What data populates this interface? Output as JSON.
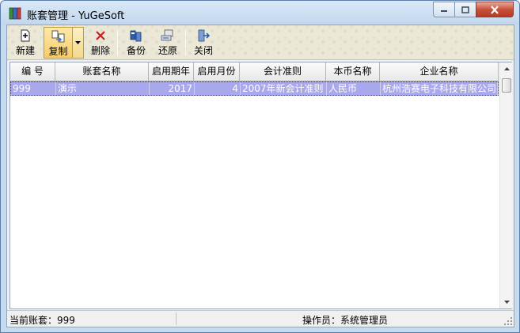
{
  "window": {
    "title": "账套管理 - YuGeSoft"
  },
  "toolbar": {
    "new_label": "新建",
    "copy_label": "复制",
    "delete_label": "删除",
    "backup_label": "备份",
    "restore_label": "还原",
    "close_label": "关闭"
  },
  "table": {
    "columns": [
      "编 号",
      "账套名称",
      "启用期年",
      "启用月份",
      "会计准则",
      "本币名称",
      "企业名称"
    ],
    "rows": [
      [
        "999",
        "演示",
        "2017",
        "4",
        "2007年新会计准则",
        "人民币",
        "杭州浩赛电子科技有限公司"
      ]
    ]
  },
  "status": {
    "current_account": "当前账套：999",
    "operator": "操作员：系统管理员"
  },
  "colors": {
    "selection": "#a9a8ec",
    "titlebar": "#c7dbef"
  }
}
